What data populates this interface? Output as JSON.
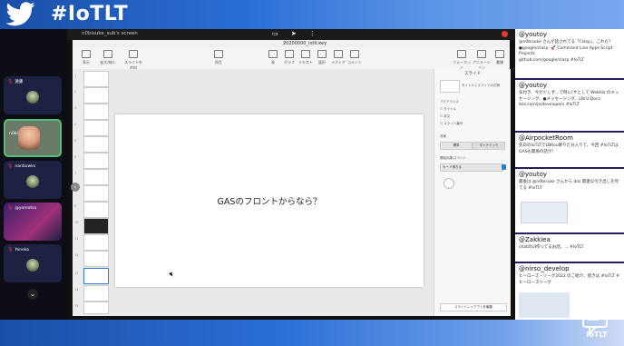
{
  "banner": {
    "hashtag": "#IoTLT"
  },
  "participants": [
    {
      "name": "遠藤"
    },
    {
      "name": "n0bisuke"
    },
    {
      "name": "nanbuwks"
    },
    {
      "name": "@yomotsu"
    },
    {
      "name": "Yoneko"
    }
  ],
  "shared_screen": {
    "window_label": "n0bisuke_sub's screen",
    "document_name": "20200000_iotlt.key",
    "toolbar": [
      "表示",
      "拡大/縮小",
      "スライドを追加",
      "再生",
      "表",
      "グラフ",
      "テキスト",
      "図形",
      "メディア",
      "コメント",
      "フォーマット",
      "アニメーション",
      "書類"
    ],
    "slide_numbers": [
      "1",
      "2",
      "3",
      "4",
      "5",
      "6",
      "7",
      "8",
      "9",
      "10",
      "11",
      "12",
      "13",
      "14",
      "15",
      "16"
    ],
    "slide_text": "GASのフロントからなら？",
    "inspector": {
      "tab": "スライド",
      "layout_label": "タイトルとスライドの左側",
      "appearance_label": "アピアランス",
      "appearance_items": [
        "タイトル",
        "本文",
        "スライド番号"
      ],
      "background_label": "背景",
      "background_buttons": [
        "標準",
        "ダイナミック"
      ],
      "transition_label": "開始効果/スライド",
      "transition_value": "カード落ちる",
      "edit_button": "スライドレイアウトを編集"
    }
  },
  "feed": {
    "tweets": [
      {
        "user": "@youtoy",
        "text": "@n0bisuke さんが話されてる「Clasp」、これだ！ ●google/clasp: 🚀 Command Line Apps Script Projects\ngithub.com/google/clasp #IoTLT"
      },
      {
        "user": "@youtoy",
        "text": "気付き、今が少しず…で時に(サとして Webhiz のメッセージング、●メッセージング…LBriz Docs ibiz.com/js/developers #IoTLT"
      },
      {
        "user": "@AirpocketRoom",
        "text": "先日のIoTLTでLBRou降りた分入りて、今回 #IoTLTはGASも関係の話が!"
      },
      {
        "user": "@youtoy",
        "text": "最後は @n0bisuke さんから ibiz 関連な引き出しを見てる #IoTLT"
      },
      {
        "user": "@Zakkiea",
        "text": "chatのUI作ってるお話、… #IoTLT"
      },
      {
        "user": "@nirso_develop",
        "text": "ヒーローズ・リーグ2022 のご紹介、続きは #IoTLT #ヒーローズリーグ"
      }
    ]
  },
  "logo": {
    "text": "IoTLT"
  },
  "colors": {
    "accent": "#2b6fd6",
    "feed_border": "#2b1b5e",
    "active_speaker": "#4ec07a"
  }
}
